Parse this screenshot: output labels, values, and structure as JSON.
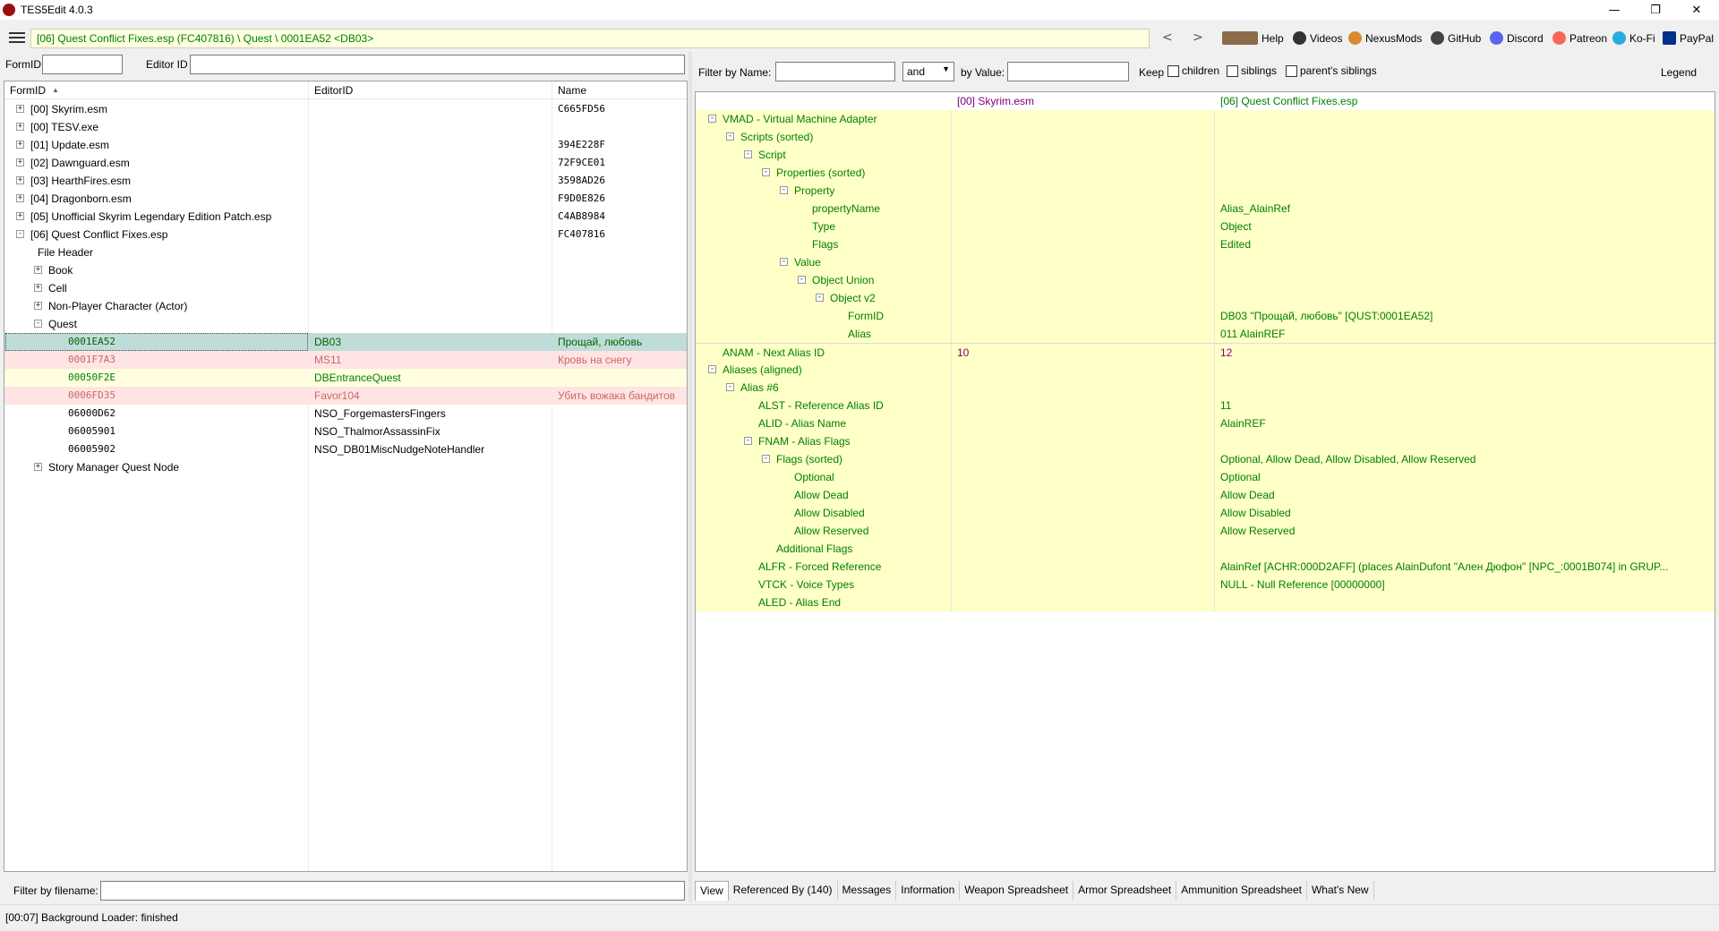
{
  "app": {
    "title": "TES5Edit 4.0.3"
  },
  "toolbar": {
    "path": "[06] Quest Conflict Fixes.esp (FC407816) \\ Quest \\ 0001EA52 <DB03>",
    "links": [
      "Help",
      "Videos",
      "NexusMods",
      "GitHub",
      "Discord",
      "Patreon",
      "Ko-Fi",
      "PayPal"
    ]
  },
  "left": {
    "formid_label": "FormID",
    "editorid_label": "Editor ID",
    "col_formid": "FormID",
    "col_editorid": "EditorID",
    "col_name": "Name",
    "filter_filename_label": "Filter by filename:"
  },
  "tree": [
    {
      "text": "[00] Skyrim.esm",
      "name": "C665FD56"
    },
    {
      "text": "[00] TESV.exe",
      "name": ""
    },
    {
      "text": "[01] Update.esm",
      "name": "394E228F"
    },
    {
      "text": "[02] Dawnguard.esm",
      "name": "72F9CE01"
    },
    {
      "text": "[03] HearthFires.esm",
      "name": "3598AD26"
    },
    {
      "text": "[04] Dragonborn.esm",
      "name": "F9D0E826"
    },
    {
      "text": "[05] Unofficial Skyrim Legendary Edition Patch.esp",
      "name": "C4AB8984"
    },
    {
      "text": "[06] Quest Conflict Fixes.esp",
      "name": "FC407816"
    },
    {
      "text": "File Header",
      "name": ""
    },
    {
      "text": "Book",
      "name": ""
    },
    {
      "text": "Cell",
      "name": ""
    },
    {
      "text": "Non-Player Character (Actor)",
      "name": ""
    },
    {
      "text": "Quest",
      "name": ""
    },
    {
      "text": "0001EA52",
      "editorid": "DB03",
      "name": "Прощай, любовь"
    },
    {
      "text": "0001F7A3",
      "editorid": "MS11",
      "name": "Кровь на снегу"
    },
    {
      "text": "00050F2E",
      "editorid": "DBEntranceQuest",
      "name": ""
    },
    {
      "text": "0006FD35",
      "editorid": "Favor104",
      "name": "Убить вожака бандитов"
    },
    {
      "text": "06000D62",
      "editorid": "NSO_ForgemastersFingers",
      "name": ""
    },
    {
      "text": "06005901",
      "editorid": "NSO_ThalmorAssassinFix",
      "name": ""
    },
    {
      "text": "06005902",
      "editorid": "NSO_DB01MiscNudgeNoteHandler",
      "name": ""
    },
    {
      "text": "Story Manager Quest Node",
      "name": ""
    }
  ],
  "right": {
    "filter_name_label": "Filter by Name:",
    "operator": "and",
    "by_value_label": "by Value:",
    "keep_label": "Keep",
    "children_label": "children",
    "siblings_label": "siblings",
    "parents_siblings_label": "parent's siblings",
    "legend_label": "Legend",
    "col1": "[00] Skyrim.esm",
    "col2": "[06] Quest Conflict Fixes.esp",
    "rows": [
      {
        "label": "VMAD - Virtual Machine Adapter",
        "v1": "",
        "v2": ""
      },
      {
        "label": "Scripts (sorted)",
        "v1": "",
        "v2": ""
      },
      {
        "label": "Script",
        "v1": "",
        "v2": ""
      },
      {
        "label": "Properties (sorted)",
        "v1": "",
        "v2": ""
      },
      {
        "label": "Property",
        "v1": "",
        "v2": ""
      },
      {
        "label": "propertyName",
        "v1": "",
        "v2": "Alias_AlainRef"
      },
      {
        "label": "Type",
        "v1": "",
        "v2": "Object"
      },
      {
        "label": "Flags",
        "v1": "",
        "v2": "Edited"
      },
      {
        "label": "Value",
        "v1": "",
        "v2": ""
      },
      {
        "label": "Object Union",
        "v1": "",
        "v2": ""
      },
      {
        "label": "Object v2",
        "v1": "",
        "v2": ""
      },
      {
        "label": "FormID",
        "v1": "",
        "v2": "DB03 \"Прощай, любовь\" [QUST:0001EA52]"
      },
      {
        "label": "Alias",
        "v1": "",
        "v2": "011 AlainREF"
      },
      {
        "label": "ANAM - Next Alias ID",
        "v1": "10",
        "v2": "12"
      },
      {
        "label": "Aliases (aligned)",
        "v1": "",
        "v2": ""
      },
      {
        "label": "Alias #6",
        "v1": "",
        "v2": ""
      },
      {
        "label": "ALST - Reference Alias ID",
        "v1": "",
        "v2": "11"
      },
      {
        "label": "ALID - Alias Name",
        "v1": "",
        "v2": "AlainREF"
      },
      {
        "label": "FNAM - Alias Flags",
        "v1": "",
        "v2": ""
      },
      {
        "label": "Flags (sorted)",
        "v1": "",
        "v2": "Optional, Allow Dead, Allow Disabled, Allow Reserved"
      },
      {
        "label": "Optional",
        "v1": "",
        "v2": "Optional"
      },
      {
        "label": "Allow Dead",
        "v1": "",
        "v2": "Allow Dead"
      },
      {
        "label": "Allow Disabled",
        "v1": "",
        "v2": "Allow Disabled"
      },
      {
        "label": "Allow Reserved",
        "v1": "",
        "v2": "Allow Reserved"
      },
      {
        "label": "Additional Flags",
        "v1": "",
        "v2": ""
      },
      {
        "label": "ALFR - Forced Reference",
        "v1": "",
        "v2": "AlainRef [ACHR:000D2AFF] (places AlainDufont \"Ален Дюфон\" [NPC_:0001B074] in GRUP..."
      },
      {
        "label": "VTCK - Voice Types",
        "v1": "",
        "v2": "NULL - Null Reference [00000000]"
      },
      {
        "label": "ALED - Alias End",
        "v1": "",
        "v2": ""
      }
    ],
    "tabs": [
      "View",
      "Referenced By (140)",
      "Messages",
      "Information",
      "Weapon Spreadsheet",
      "Armor Spreadsheet",
      "Ammunition Spreadsheet",
      "What's New"
    ]
  },
  "status": "[00:07] Background Loader: finished"
}
